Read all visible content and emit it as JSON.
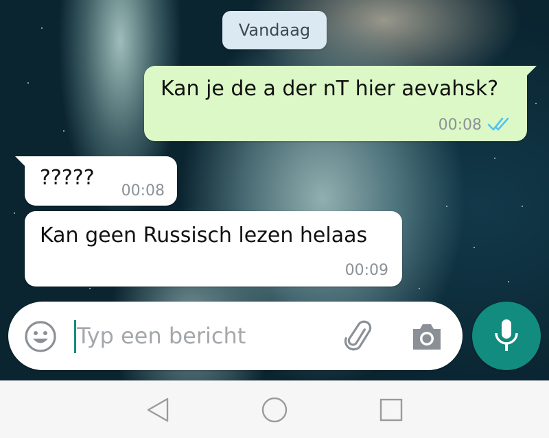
{
  "chat": {
    "date_chip": "Vandaag",
    "messages": [
      {
        "direction": "outgoing",
        "text": "Kan je de a der nT hier aevahsk?",
        "time": "00:08",
        "status": "read"
      },
      {
        "direction": "incoming",
        "text": "?????",
        "time": "00:08"
      },
      {
        "direction": "incoming",
        "text": "Kan geen Russisch lezen helaas",
        "time": "00:09"
      }
    ]
  },
  "composer": {
    "placeholder": "Typ een bericht",
    "value": "",
    "icons": {
      "emoji": "emoji-icon",
      "attach": "paperclip-icon",
      "camera": "camera-icon",
      "mic": "microphone-icon"
    }
  },
  "navbar": {
    "icons": [
      "back-triangle-icon",
      "home-circle-icon",
      "recents-square-icon"
    ]
  },
  "colors": {
    "outgoing_bubble": "#dcf8c6",
    "incoming_bubble": "#ffffff",
    "accent": "#128c7e",
    "read_ticks": "#4fc3f7",
    "date_chip": "#dbe9f2"
  }
}
